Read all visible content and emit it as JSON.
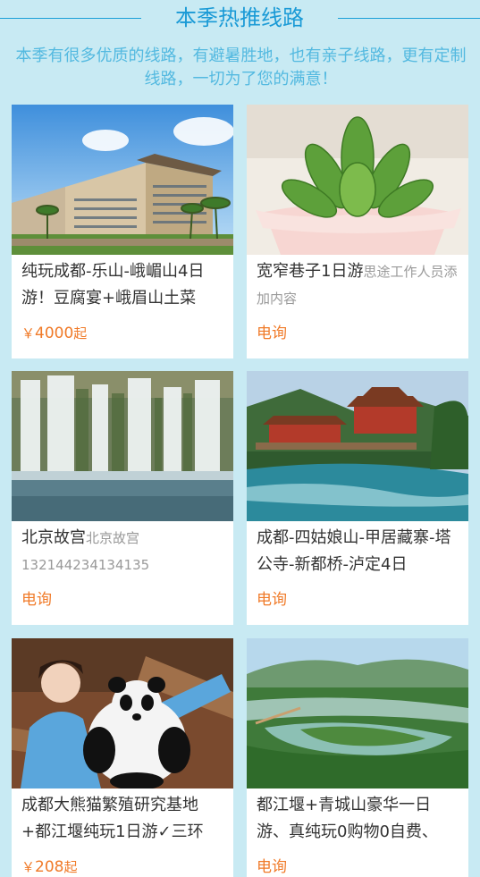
{
  "section": {
    "title": "本季热推线路",
    "subtitle": "本季有很多优质的线路，有避暑胜地，也有亲子线路，更有定制线路，一切为了您的满意！"
  },
  "cards": [
    {
      "image": "hotel-building-photo",
      "title": "纯玩成都-乐山-峨嵋山4日游！豆腐宴+峨眉山土菜",
      "desc": "",
      "price_symbol": "￥",
      "price": "4000",
      "price_unit": "起"
    },
    {
      "image": "succulent-plant-photo",
      "title": "宽窄巷子1日游",
      "desc": "思途工作人员添加内容",
      "price_symbol": "",
      "price": "电询",
      "price_unit": ""
    },
    {
      "image": "waterfall-photo",
      "title": "北京故宫",
      "desc": "北京故宫132144234134135",
      "price_symbol": "",
      "price": "电询",
      "price_unit": ""
    },
    {
      "image": "river-temple-photo",
      "title": "成都-四姑娘山-甲居藏寨-塔公寺-新都桥-泸定4日",
      "desc": "",
      "price_symbol": "",
      "price": "电询",
      "price_unit": ""
    },
    {
      "image": "panda-keeper-photo",
      "title": "成都大熊猫繁殖研究基地+都江堰纯玩1日游✓三环",
      "desc": "",
      "price_symbol": "￥",
      "price": "208",
      "price_unit": "起"
    },
    {
      "image": "dujiangyan-aerial-photo",
      "title": "都江堰+青城山豪华一日游、真纯玩0购物0自费、",
      "desc": "",
      "price_symbol": "",
      "price": "电询",
      "price_unit": ""
    }
  ],
  "colors": {
    "background": "#c8eaf3",
    "accent": "#1a9ad6",
    "price": "#f07a28"
  }
}
